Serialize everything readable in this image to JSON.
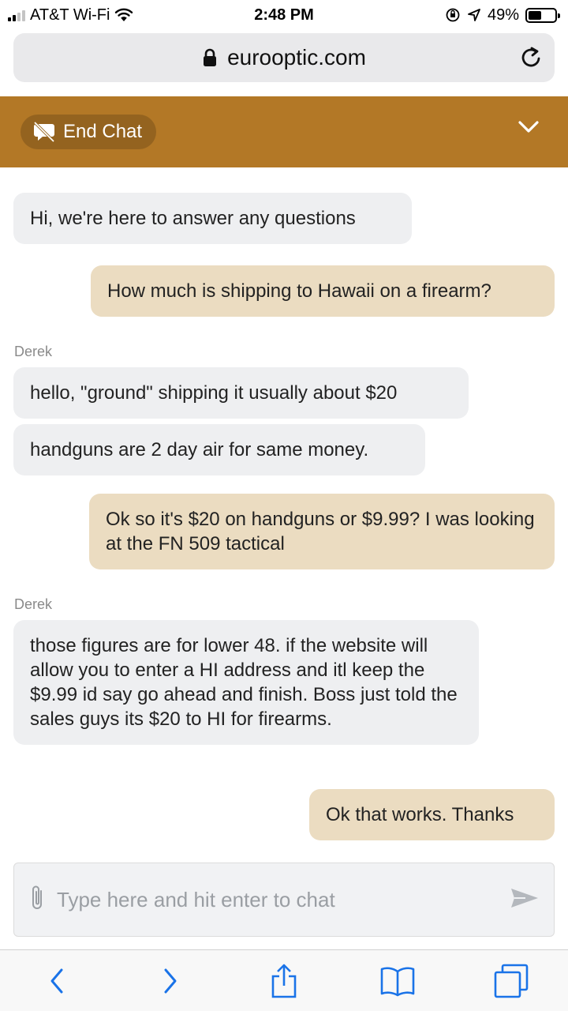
{
  "status_bar": {
    "carrier": "AT&T Wi-Fi",
    "time": "2:48 PM",
    "battery": "49%",
    "battery_level": 0.49,
    "signal_bars": 2
  },
  "browser": {
    "url": "eurooptic.com"
  },
  "chat_header": {
    "end_chat_label": "End Chat"
  },
  "messages": [
    {
      "from": "agent",
      "text": "Hi, we're here to answer any questions"
    },
    {
      "from": "user",
      "text": "How much is shipping to Hawaii on a firearm?"
    },
    {
      "from": "agent",
      "sender": "Derek",
      "text": "hello, \"ground\" shipping it usually about $20"
    },
    {
      "from": "agent",
      "text": "handguns are 2 day air for same money."
    },
    {
      "from": "user",
      "text": "Ok so it's $20 on handguns or $9.99? I was looking at the FN 509 tactical"
    },
    {
      "from": "agent",
      "sender": "Derek",
      "text": "those figures are for lower 48. if the website will allow you to enter a HI address and itl keep the $9.99 id say go ahead and finish. Boss just told the sales guys its $20 to HI for firearms."
    },
    {
      "from": "user",
      "text": "Ok that works. Thanks"
    }
  ],
  "composer": {
    "placeholder": "Type here and hit enter to chat"
  },
  "colors": {
    "header": "#b37826",
    "agent_bubble": "#eeeff1",
    "user_bubble": "#ebdcc1",
    "ios_blue": "#1a73e8"
  },
  "icons": {
    "attach": "paperclip-icon",
    "send": "send-icon",
    "end_chat": "chat-off-icon",
    "collapse": "chevron-down-icon",
    "toolbar": [
      "back-icon",
      "forward-icon",
      "share-icon",
      "bookmarks-icon",
      "tabs-icon"
    ]
  }
}
